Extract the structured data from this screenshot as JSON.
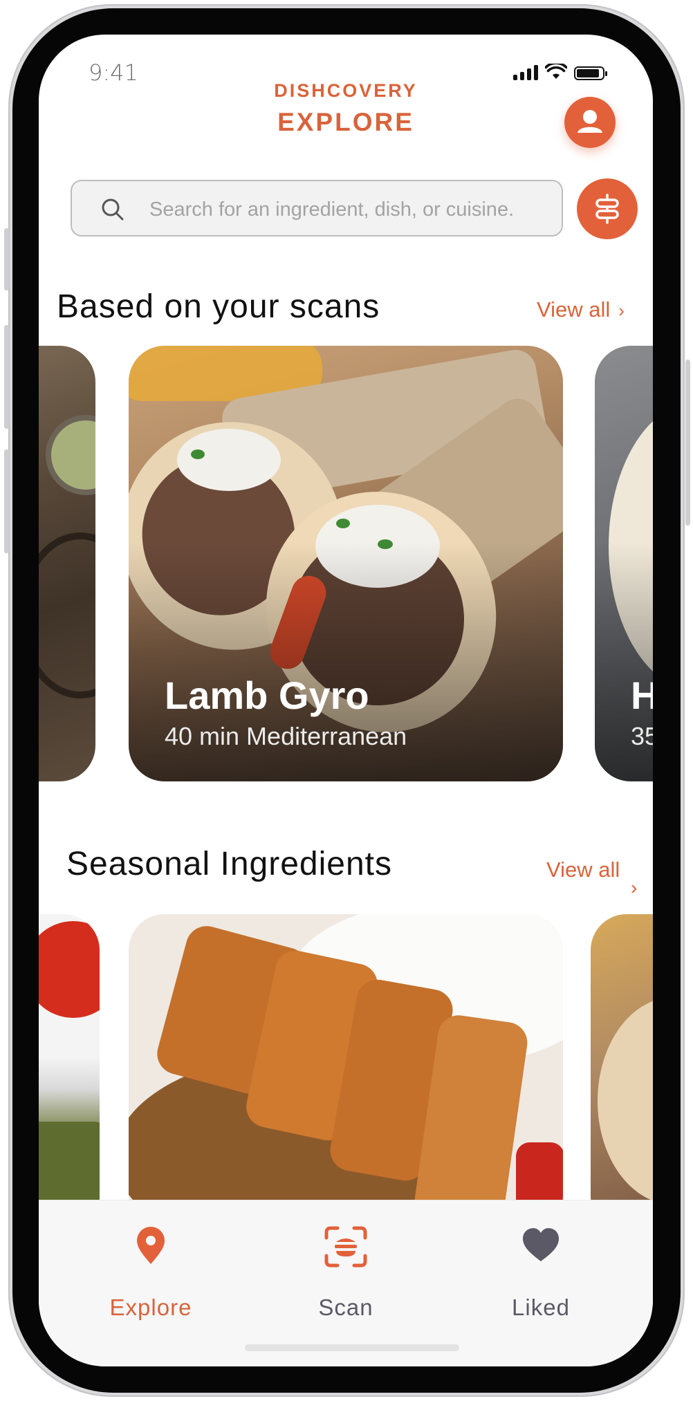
{
  "status_bar": {
    "time": "9:41"
  },
  "header": {
    "brand": "DISHCOVERY",
    "title": "EXPLORE"
  },
  "search": {
    "placeholder": "Search for an ingredient, dish, or cuisine."
  },
  "sections": {
    "scans": {
      "title": "Based on your scans",
      "view_all": "View all",
      "featured_card": {
        "title": "Lamb Gyro",
        "meta": "40 min  Mediterranean"
      },
      "right_card": {
        "title_partial": "H",
        "meta_partial": "35"
      }
    },
    "seasonal": {
      "title": "Seasonal Ingredients",
      "view_all": "View all"
    }
  },
  "nav": {
    "items": [
      {
        "label": "Explore",
        "icon": "location-pin-icon",
        "active": true
      },
      {
        "label": "Scan",
        "icon": "scan-icon",
        "active": false
      },
      {
        "label": "Liked",
        "icon": "heart-icon",
        "active": false
      }
    ]
  },
  "colors": {
    "accent": "#e2613a",
    "accent_text": "#d9633a",
    "nav_inactive": "#5b5966"
  }
}
